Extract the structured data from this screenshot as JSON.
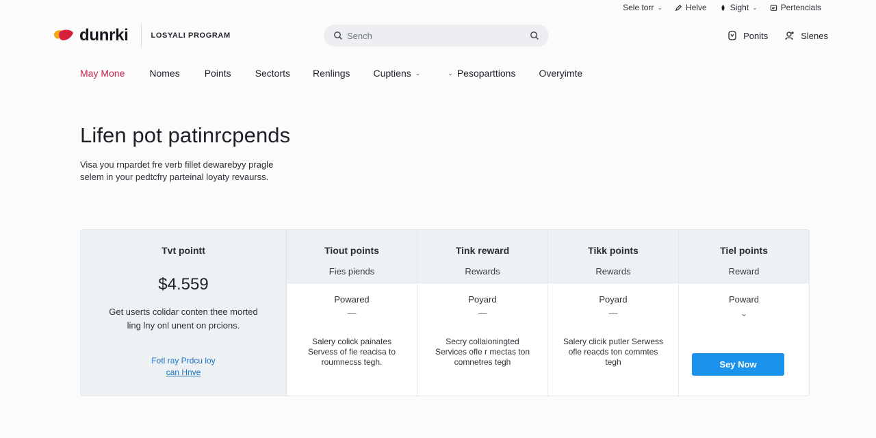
{
  "utility": {
    "items": [
      {
        "label": "Sele torr",
        "icon": "none",
        "has_chevron": true
      },
      {
        "label": "Helve",
        "icon": "pencil-icon",
        "has_chevron": false
      },
      {
        "label": "Sight",
        "icon": "sign-icon",
        "has_chevron": true
      },
      {
        "label": "Pertencials",
        "icon": "document-icon",
        "has_chevron": false
      }
    ]
  },
  "header": {
    "logo_text": "dunrki",
    "program_label": "LOSYALI PROGRAM",
    "search_placeholder": "Sench",
    "right_items": [
      {
        "label": "Ponits",
        "icon": "badge-icon"
      },
      {
        "label": "Slenes",
        "icon": "users-icon"
      }
    ]
  },
  "nav": {
    "items": [
      {
        "label": "May Mone",
        "active": true
      },
      {
        "label": "Nomes"
      },
      {
        "label": "Points"
      },
      {
        "label": "Sectorts"
      },
      {
        "label": "Renlings"
      },
      {
        "label": "Cuptiens",
        "chevron": "after"
      },
      {
        "label": "Pesoparttions",
        "chevron": "before"
      },
      {
        "label": "Overyimte"
      }
    ]
  },
  "hero": {
    "title": "Lifen pot patinrcpends",
    "text_line1": "Visa you rnpardet fre verb fillet dewarebyy pragle",
    "text_line2": "selem in your pedtcfry parteinal loyaty revaurss."
  },
  "table": {
    "summary": {
      "title": "Tvt pointt",
      "value": "$4.559",
      "desc": "Get userts colidar conten thee morted ling lny onl unent on prcions.",
      "link_line1": "Fotl ray Prdcu loy",
      "link_line2": "can Hnve"
    },
    "columns": [
      {
        "title": "Tiout points",
        "sub": "Fies piends",
        "row": "Powared",
        "mark": "—",
        "desc": "Salery colick painates Servess of fie reacisa to roumnecss tegh."
      },
      {
        "title": "Tink reward",
        "sub": "Rewards",
        "row": "Poyard",
        "mark": "—",
        "desc": "Secry collaioningted Services ofle r mectas ton comnetres tegh"
      },
      {
        "title": "Tikk points",
        "sub": "Rewards",
        "row": "Poyard",
        "mark": "—",
        "desc": "Salery clicik putler Serwess ofle reacds ton commtes tegh"
      },
      {
        "title": "Tiel points",
        "sub": "Reward",
        "row": "Poward",
        "mark": "⌄",
        "cta": "Sey Now"
      }
    ]
  },
  "colors": {
    "accent": "#c8224e",
    "button": "#1b93ec",
    "link": "#1a73c4",
    "table_head": "#eef1f4"
  }
}
